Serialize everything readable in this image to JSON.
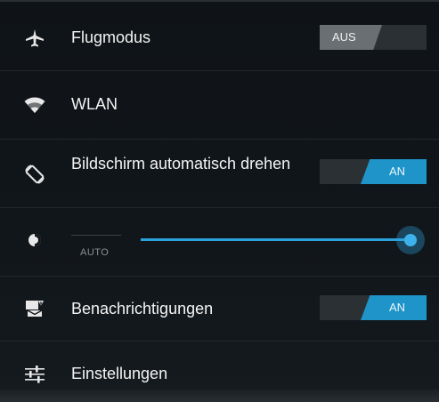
{
  "quick_settings": {
    "airplane": {
      "label": "Flugmodus",
      "icon": "airplane-icon",
      "toggle_label": "AUS",
      "state": "off"
    },
    "wifi": {
      "label": "WLAN",
      "icon": "wifi-icon"
    },
    "auto_rotate": {
      "label": "Bildschirm automatisch drehen",
      "icon": "rotate-icon",
      "toggle_label": "AN",
      "state": "on"
    },
    "brightness": {
      "icon": "brightness-icon",
      "auto_label": "AUTO",
      "level": 1.0
    },
    "notifications": {
      "label": "Benachrichtigungen",
      "icon": "notification-icon",
      "toggle_label": "AN",
      "state": "on"
    },
    "settings": {
      "label": "Einstellungen",
      "icon": "settings-sliders-icon"
    }
  },
  "colors": {
    "background": "#101418",
    "accent": "#1f94c9",
    "toggle_off": "#6a6f73",
    "divider": "#22272b"
  }
}
